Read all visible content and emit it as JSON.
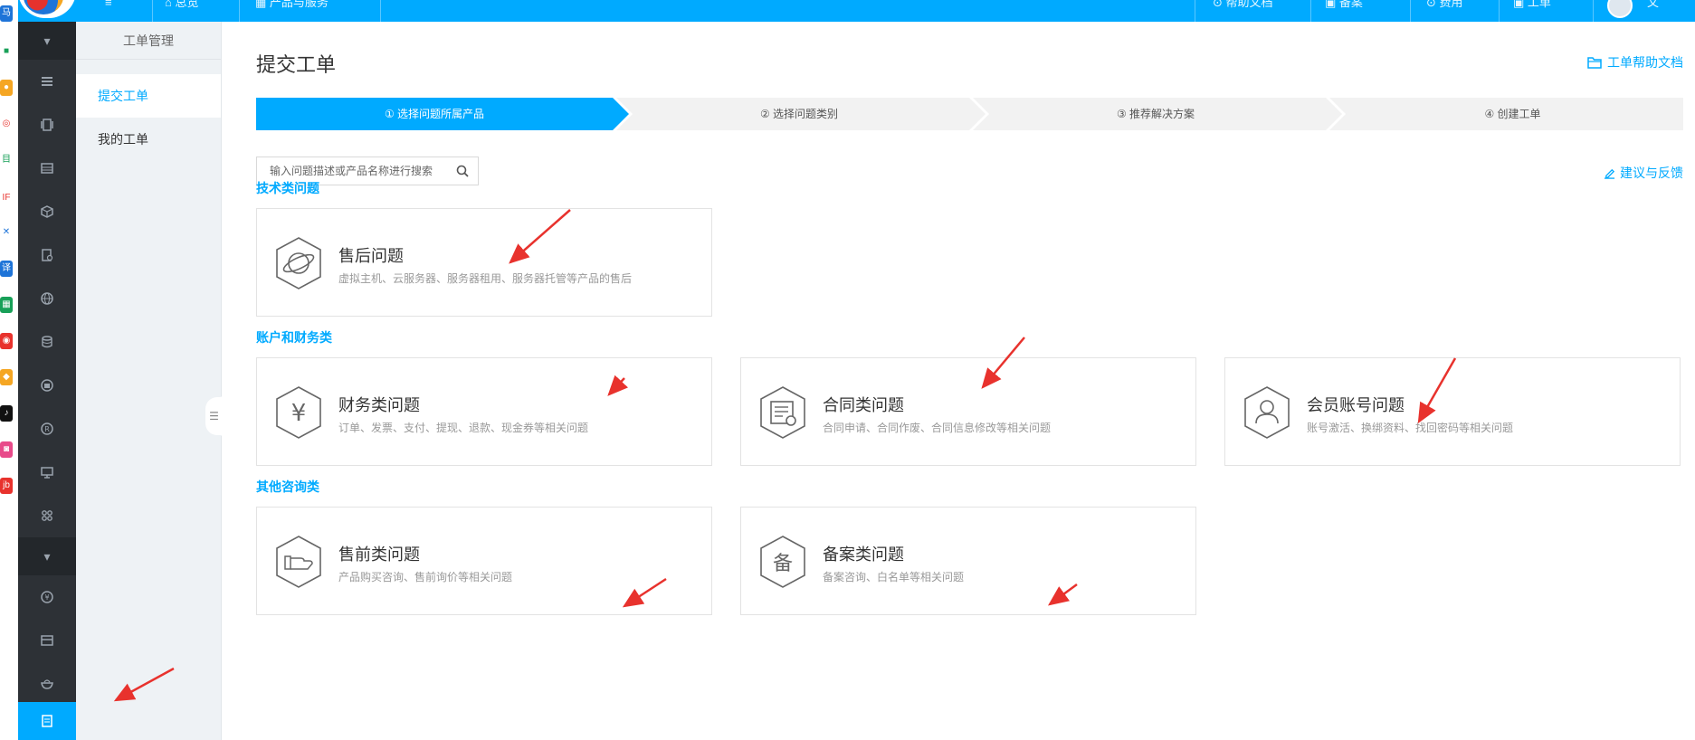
{
  "topbar": {
    "items": [
      "总览",
      "产品与服务",
      "帮助文档",
      "备案",
      "费用",
      "工单"
    ],
    "user_label": "文"
  },
  "submenu": {
    "title": "工单管理",
    "items": [
      {
        "label": "提交工单",
        "active": true
      },
      {
        "label": "我的工单",
        "active": false
      }
    ]
  },
  "page": {
    "title": "提交工单",
    "help_link": "工单帮助文档",
    "feedback_link": "建议与反馈"
  },
  "steps": [
    {
      "label": "① 选择问题所属产品",
      "active": true
    },
    {
      "label": "② 选择问题类别",
      "active": false
    },
    {
      "label": "③ 推荐解决方案",
      "active": false
    },
    {
      "label": "④ 创建工单",
      "active": false
    }
  ],
  "search": {
    "placeholder": "输入问题描述或产品名称进行搜索"
  },
  "sections": [
    {
      "title": "技术类问题",
      "cards": [
        {
          "title": "售后问题",
          "desc": "虚拟主机、云服务器、服务器租用、服务器托管等产品的售后",
          "icon": "planet-icon"
        }
      ]
    },
    {
      "title": "账户和财务类",
      "cards": [
        {
          "title": "财务类问题",
          "desc": "订单、发票、支付、提现、退款、现金券等相关问题",
          "icon": "yuan-icon"
        },
        {
          "title": "合同类问题",
          "desc": "合同申请、合同作废、合同信息修改等相关问题",
          "icon": "contract-icon"
        },
        {
          "title": "会员账号问题",
          "desc": "账号激活、换绑资料、找回密码等相关问题",
          "icon": "user-icon"
        }
      ]
    },
    {
      "title": "其他咨询类",
      "cards": [
        {
          "title": "售前类问题",
          "desc": "产品购买咨询、售前询价等相关问题",
          "icon": "hand-icon"
        },
        {
          "title": "备案类问题",
          "desc": "备案咨询、白名单等相关问题",
          "icon": "bei-icon"
        }
      ]
    }
  ],
  "colors": {
    "primary": "#00aaff",
    "sidebar_dark": "#2d3136",
    "annotation_arrow": "#e8322d"
  }
}
